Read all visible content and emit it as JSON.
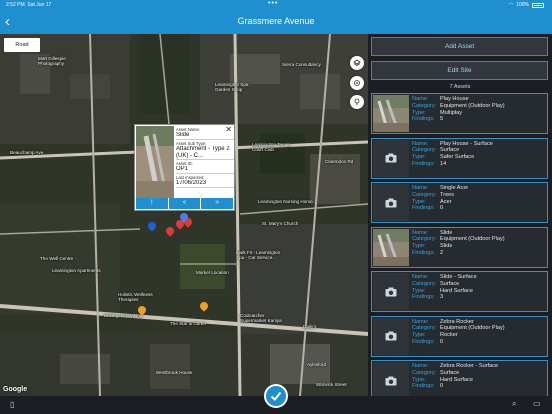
{
  "status": {
    "time": "2:52 PM",
    "date": "Sat Jun 17",
    "battery": "100%"
  },
  "nav": {
    "title": "Grassmere Avenue",
    "back_icon": "chevron-left-icon"
  },
  "map": {
    "type_button": "Road",
    "attribution": "Google",
    "labels": {
      "matt": "Matt Gillespie\nPhotography",
      "leamington_spa_shop": "Leamington Spa\nGarden Shop",
      "sierra": "Sierra Consultancy",
      "beauchamp": "Beauchamp Ave",
      "leamington_tennis": "Leamington Tennis\nCourt Club",
      "clarendon": "Clarendon Rd",
      "leamington_nursing": "Leamington Nursing Home",
      "church": "St. Mary's Church",
      "kwik_fit": "Kwik Fit - Leamington\nSpa - Car Service...",
      "market": "Market Location",
      "the_well": "The Well Centre",
      "leamington_apartments": "Leamington Apartments",
      "holistic": "Holistic Wellness\nTherapies",
      "baking": "Baking and Baking",
      "star_garter": "The Star & Garter",
      "coolcatcher": "Coolcatcher\nSupermarket Kaniya",
      "dailys": "Daily's",
      "westbrook": "Westbrook House",
      "aylesford": "Aylesford",
      "warwick": "Warwick Street"
    }
  },
  "popup": {
    "name_label": "Asset Name:",
    "name": "Slide",
    "subtype_label": "Asset Sub Type:",
    "subtype": "Attachment - Type 2 (UK) - C...",
    "id_label": "Asset ID:",
    "id": "OP1",
    "inspected_label": "Last Inspected:",
    "inspected": "17/06/2023",
    "buttons": [
      "!",
      "<",
      ">"
    ]
  },
  "panel": {
    "add_asset": "Add Asset",
    "edit_site": "Edit Site",
    "count": "7 Assets",
    "field_labels": {
      "name": "Name:",
      "category": "Category:",
      "type": "Type:",
      "findings": "Findings:"
    },
    "assets": [
      {
        "name": "Play House",
        "category": "Equipment (Outdoor Play)",
        "type": "Multiplay",
        "findings": "5",
        "has_photo": true
      },
      {
        "name": "Play House - Surface",
        "category": "Surface",
        "type": "Safer Surface",
        "findings": "14",
        "has_photo": false
      },
      {
        "name": "Single Acer",
        "category": "Trees",
        "type": "Acer",
        "findings": "0",
        "has_photo": false
      },
      {
        "name": "Slide",
        "category": "Equipment (Outdoor Play)",
        "type": "Slide",
        "findings": "2",
        "has_photo": true
      },
      {
        "name": "Slide - Surface",
        "category": "Surface",
        "type": "Hard Surface",
        "findings": "3",
        "has_photo": false
      },
      {
        "name": "Zebra Rocker",
        "category": "Equipment (Outdoor Play)",
        "type": "Rocker",
        "findings": "0",
        "has_photo": false
      },
      {
        "name": "Zebra Rocker - Surface",
        "category": "Surface",
        "type": "Hard Surface",
        "findings": "0",
        "has_photo": false
      }
    ]
  },
  "colors": {
    "accent": "#1f8fcf",
    "label_blue": "#3aa3e0",
    "panel_bg": "#1b1f23"
  }
}
